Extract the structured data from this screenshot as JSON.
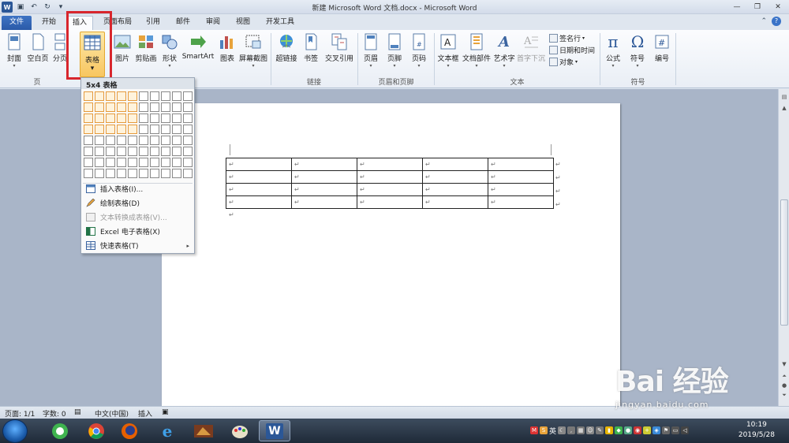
{
  "window": {
    "title": "新建 Microsoft Word 文档.docx - Microsoft Word",
    "app_icon": "W"
  },
  "tabs": [
    "文件",
    "开始",
    "插入",
    "页面布局",
    "引用",
    "邮件",
    "审阅",
    "视图",
    "开发工具"
  ],
  "active_tab": "插入",
  "ribbon": {
    "buttons": {
      "cover": "封面",
      "blank": "空白页",
      "break": "分页",
      "table": "表格",
      "picture": "图片",
      "clipart": "剪贴画",
      "shapes": "形状",
      "smartart": "SmartArt",
      "chart": "图表",
      "screenshot": "屏幕截图",
      "hyperlink": "超链接",
      "bookmark": "书签",
      "crossref": "交叉引用",
      "header": "页眉",
      "footer": "页脚",
      "pagenum": "页码",
      "textbox": "文本框",
      "quickparts": "文档部件",
      "wordart": "艺术字",
      "dropcap": "首字下沉",
      "signature": "签名行",
      "datetime": "日期和时间",
      "object": "对象",
      "equation": "公式",
      "symbol": "符号",
      "number": "编号"
    },
    "groups": {
      "pages": "页",
      "links": "链接",
      "header_footer": "页眉和页脚",
      "text": "文本",
      "symbols": "符号"
    }
  },
  "table_menu": {
    "header": "5x4 表格",
    "grid_cols": 10,
    "grid_rows": 8,
    "selected_cols": 5,
    "selected_rows": 4,
    "items": [
      "插入表格(I)...",
      "绘制表格(D)",
      "文本转换成表格(V)...",
      "Excel 电子表格(X)",
      "快速表格(T)"
    ],
    "disabled_item": "文本转换成表格(V)..."
  },
  "document": {
    "table_rows": 4,
    "table_cols": 5,
    "cell_mark": "↵"
  },
  "statusbar": {
    "page": "页面: 1/1",
    "words": "字数: 0",
    "language": "中文(中国)",
    "mode": "插入"
  },
  "taskbar": {
    "time": "10:19",
    "date": "2019/5/28",
    "ime": "英"
  },
  "watermark": {
    "brand": "Bai 经验",
    "url": "jingyan.baidu.com"
  }
}
